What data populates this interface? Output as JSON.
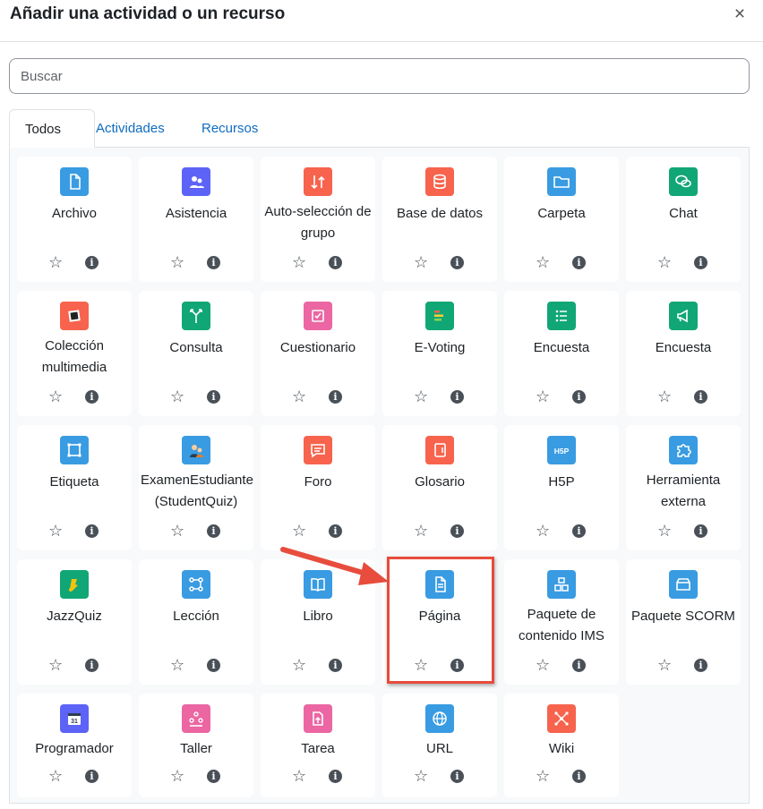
{
  "modal": {
    "title": "Añadir una actividad o un recurso",
    "close_symbol": "×"
  },
  "search": {
    "placeholder": "Buscar",
    "value": ""
  },
  "tabs": [
    {
      "label": "Todos",
      "active": true
    },
    {
      "label": "Actividades",
      "active": false
    },
    {
      "label": "Recursos",
      "active": false
    }
  ],
  "card_controls": {
    "star_symbol": "☆",
    "info_symbol": "i"
  },
  "items": [
    {
      "name": "Archivo",
      "icon": "file-icon",
      "color": "#399be2"
    },
    {
      "name": "Asistencia",
      "icon": "attendance-icon",
      "color": "#5d63f6"
    },
    {
      "name": "Auto-selección de grupo",
      "icon": "group-select-icon",
      "color": "#f7634d"
    },
    {
      "name": "Base de datos",
      "icon": "database-icon",
      "color": "#f7634d"
    },
    {
      "name": "Carpeta",
      "icon": "folder-icon",
      "color": "#399be2"
    },
    {
      "name": "Chat",
      "icon": "chat-icon",
      "color": "#11a676"
    },
    {
      "name": "Colección multimedia",
      "icon": "media-collection-icon",
      "color": "#f7634d"
    },
    {
      "name": "Consulta",
      "icon": "choice-icon",
      "color": "#11a676"
    },
    {
      "name": "Cuestionario",
      "icon": "quiz-icon",
      "color": "#eb66a2"
    },
    {
      "name": "E-Voting",
      "icon": "evoting-icon",
      "color": "#11a676"
    },
    {
      "name": "Encuesta",
      "icon": "survey-list-icon",
      "color": "#11a676"
    },
    {
      "name": "Encuesta",
      "icon": "feedback-megaphone-icon",
      "color": "#11a676"
    },
    {
      "name": "Etiqueta",
      "icon": "label-icon",
      "color": "#399be2"
    },
    {
      "name": "ExamenEstudiante (StudentQuiz)",
      "icon": "studentquiz-icon",
      "color": "#399be2"
    },
    {
      "name": "Foro",
      "icon": "forum-icon",
      "color": "#f7634d"
    },
    {
      "name": "Glosario",
      "icon": "glossary-icon",
      "color": "#f7634d"
    },
    {
      "name": "H5P",
      "icon": "h5p-icon",
      "color": "#399be2"
    },
    {
      "name": "Herramienta externa",
      "icon": "puzzle-icon",
      "color": "#399be2"
    },
    {
      "name": "JazzQuiz",
      "icon": "jazzquiz-icon",
      "color": "#11a676"
    },
    {
      "name": "Lección",
      "icon": "lesson-icon",
      "color": "#399be2"
    },
    {
      "name": "Libro",
      "icon": "book-icon",
      "color": "#399be2"
    },
    {
      "name": "Página",
      "icon": "page-icon",
      "color": "#399be2"
    },
    {
      "name": "Paquete de contenido IMS",
      "icon": "ims-package-icon",
      "color": "#399be2"
    },
    {
      "name": "Paquete SCORM",
      "icon": "scorm-box-icon",
      "color": "#399be2"
    },
    {
      "name": "Programador",
      "icon": "scheduler-icon",
      "color": "#5d63f6"
    },
    {
      "name": "Taller",
      "icon": "workshop-icon",
      "color": "#eb66a2"
    },
    {
      "name": "Tarea",
      "icon": "assignment-icon",
      "color": "#eb66a2"
    },
    {
      "name": "URL",
      "icon": "globe-icon",
      "color": "#399be2"
    },
    {
      "name": "Wiki",
      "icon": "wiki-icon",
      "color": "#f7634d"
    }
  ],
  "highlighted_item": "Página"
}
